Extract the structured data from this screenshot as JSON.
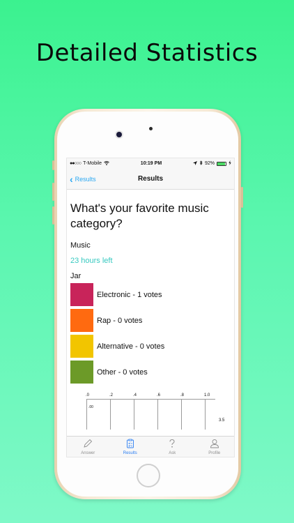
{
  "headline": "Detailed Statistics",
  "status": {
    "signal_dots": "●●○○○",
    "carrier": "T-Mobile",
    "wifi_icon": "wifi-icon",
    "time": "10:19 PM",
    "location_icon": "location-arrow-icon",
    "bluetooth_icon": "bluetooth-icon",
    "battery_text": "92%",
    "battery_level": 0.92
  },
  "nav": {
    "back_label": "Results",
    "title": "Results"
  },
  "poll": {
    "question": "What's your favorite music category?",
    "category": "Music",
    "time_left": "23 hours left",
    "owner": "Jar",
    "options": [
      {
        "label": "Electronic - 1 votes",
        "color": "#c8245a"
      },
      {
        "label": "Rap - 0 votes",
        "color": "#ff6a10"
      },
      {
        "label": "Alternative - 0 votes",
        "color": "#f2c500"
      },
      {
        "label": "Other - 0 votes",
        "color": "#6c9a28"
      }
    ]
  },
  "chart_data": {
    "type": "bar",
    "tick_labels": [
      ".0",
      ".2",
      ".4",
      ".6",
      ".8",
      "1.0"
    ],
    "ticks": [
      0,
      0.2,
      0.4,
      0.6,
      0.8,
      1.0
    ],
    "xlim": [
      0,
      1.0
    ],
    "annotations": [
      ".00",
      "3.5"
    ]
  },
  "tabs": [
    {
      "label": "Answer",
      "icon": "pencil-icon",
      "active": false
    },
    {
      "label": "Results",
      "icon": "clipboard-icon",
      "active": true
    },
    {
      "label": "Ask",
      "icon": "question-icon",
      "active": false
    },
    {
      "label": "Profile",
      "icon": "person-icon",
      "active": false
    }
  ]
}
